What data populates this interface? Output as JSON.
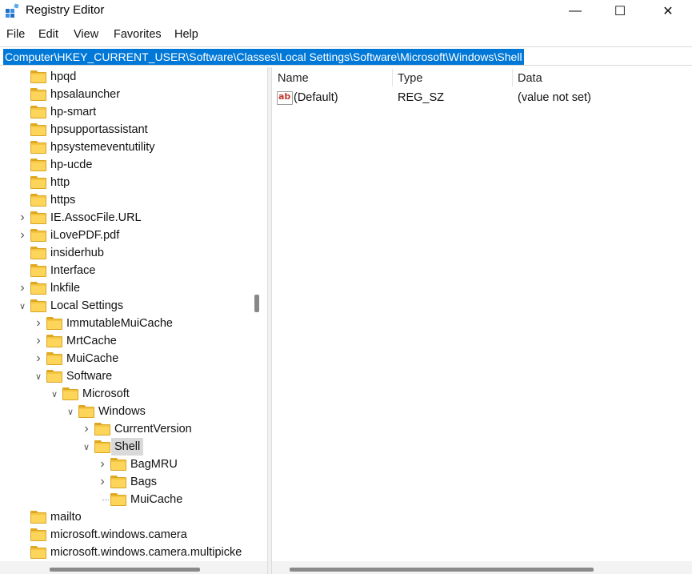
{
  "window": {
    "title": "Registry Editor"
  },
  "window_controls": {
    "minimize": "—",
    "maximize": "☐",
    "close": "✕"
  },
  "menu": [
    "File",
    "Edit",
    "View",
    "Favorites",
    "Help"
  ],
  "address": "Computer\\HKEY_CURRENT_USER\\Software\\Classes\\Local Settings\\Software\\Microsoft\\Windows\\Shell",
  "tree": {
    "items": [
      {
        "label": "hpqd",
        "level": 0,
        "expander": "none"
      },
      {
        "label": "hpsalauncher",
        "level": 0,
        "expander": "none"
      },
      {
        "label": "hp-smart",
        "level": 0,
        "expander": "none"
      },
      {
        "label": "hpsupportassistant",
        "level": 0,
        "expander": "none"
      },
      {
        "label": "hpsystemeventutility",
        "level": 0,
        "expander": "none"
      },
      {
        "label": "hp-ucde",
        "level": 0,
        "expander": "none"
      },
      {
        "label": "http",
        "level": 0,
        "expander": "none"
      },
      {
        "label": "https",
        "level": 0,
        "expander": "none"
      },
      {
        "label": "IE.AssocFile.URL",
        "level": 0,
        "expander": "collapsed"
      },
      {
        "label": "iLovePDF.pdf",
        "level": 0,
        "expander": "collapsed"
      },
      {
        "label": "insiderhub",
        "level": 0,
        "expander": "none"
      },
      {
        "label": "Interface",
        "level": 0,
        "expander": "none"
      },
      {
        "label": "lnkfile",
        "level": 0,
        "expander": "collapsed"
      },
      {
        "label": "Local Settings",
        "level": 0,
        "expander": "expanded"
      },
      {
        "label": "ImmutableMuiCache",
        "level": 1,
        "expander": "collapsed"
      },
      {
        "label": "MrtCache",
        "level": 1,
        "expander": "collapsed"
      },
      {
        "label": "MuiCache",
        "level": 1,
        "expander": "collapsed"
      },
      {
        "label": "Software",
        "level": 1,
        "expander": "expanded"
      },
      {
        "label": "Microsoft",
        "level": 2,
        "expander": "expanded"
      },
      {
        "label": "Windows",
        "level": 3,
        "expander": "expanded"
      },
      {
        "label": "CurrentVersion",
        "level": 4,
        "expander": "collapsed"
      },
      {
        "label": "Shell",
        "level": 4,
        "expander": "expanded",
        "selected": true
      },
      {
        "label": "BagMRU",
        "level": 5,
        "expander": "collapsed"
      },
      {
        "label": "Bags",
        "level": 5,
        "expander": "collapsed"
      },
      {
        "label": "MuiCache",
        "level": 5,
        "expander": "none"
      },
      {
        "label": "mailto",
        "level": 0,
        "expander": "none"
      },
      {
        "label": "microsoft.windows.camera",
        "level": 0,
        "expander": "none"
      },
      {
        "label": "microsoft.windows.camera.multipicke",
        "level": 0,
        "expander": "none"
      }
    ]
  },
  "values": {
    "columns": [
      "Name",
      "Type",
      "Data"
    ],
    "rows": [
      {
        "icon": "string-value-icon",
        "name": "(Default)",
        "type": "REG_SZ",
        "data": "(value not set)"
      }
    ]
  },
  "colors": {
    "selection": "#0078d7",
    "folder": "#f5c542"
  }
}
